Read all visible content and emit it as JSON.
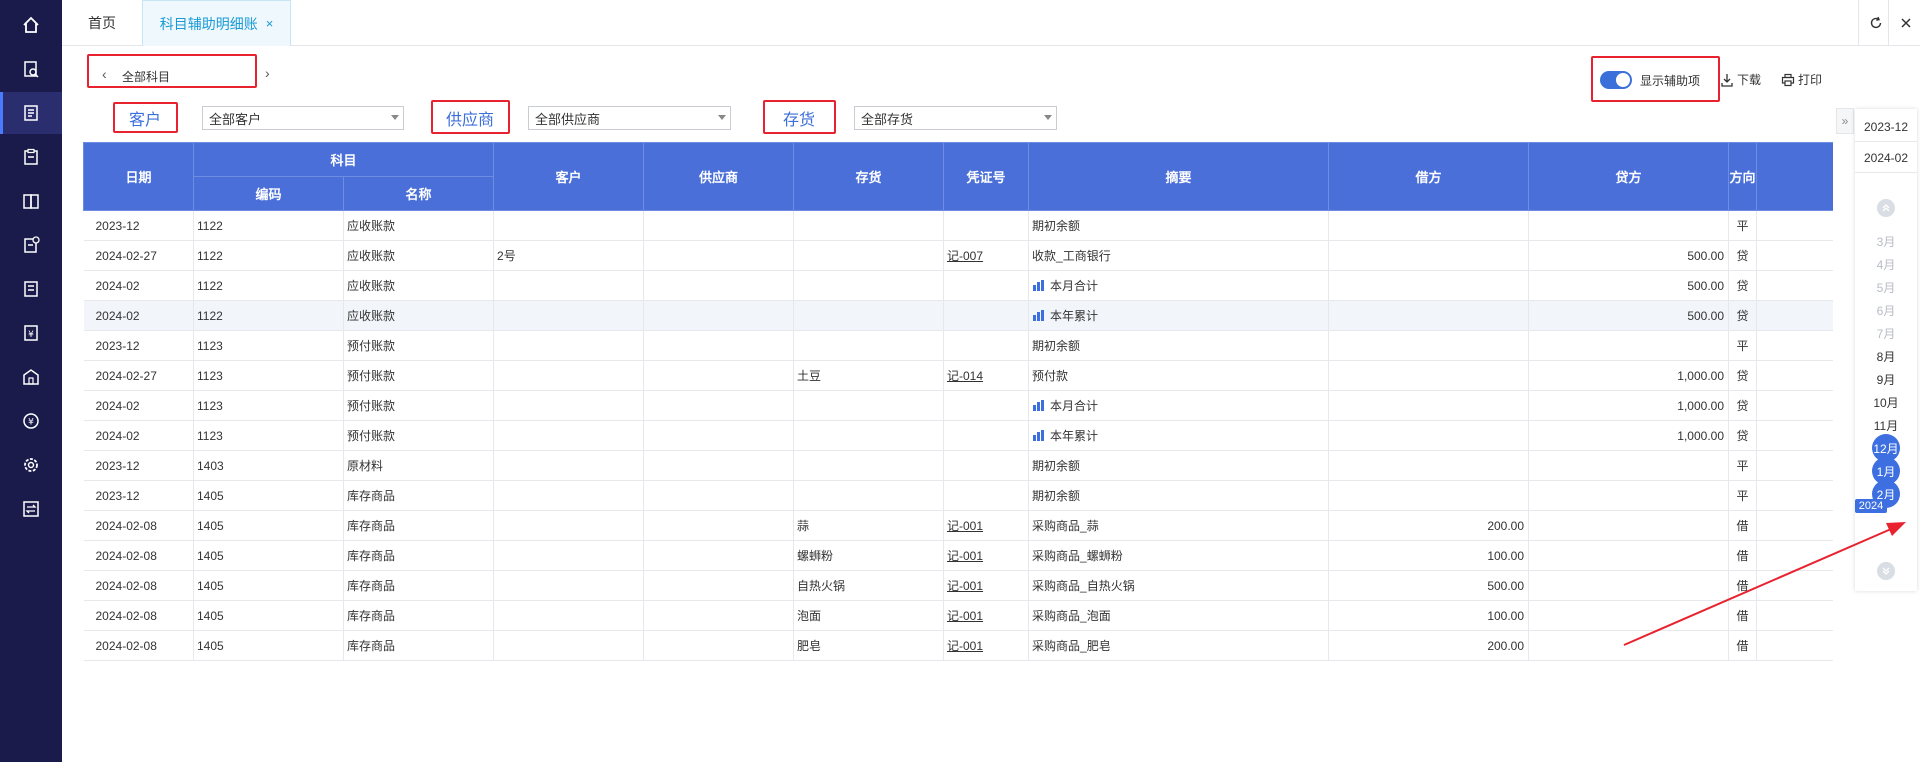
{
  "tabs": {
    "home_label": "首页",
    "active_label": "科目辅助明细账",
    "close_glyph": "×"
  },
  "nav": {
    "subject_label": "全部科目",
    "prev_glyph": "‹",
    "next_glyph": "›"
  },
  "filters": {
    "customer": {
      "label": "客户",
      "value": "全部客户"
    },
    "supplier": {
      "label": "供应商",
      "value": "全部供应商"
    },
    "inventory": {
      "label": "存货",
      "value": "全部存货"
    }
  },
  "toolbar": {
    "toggle_label": "显示辅助项",
    "toggle_on": true,
    "download_label": "下载",
    "print_label": "打印"
  },
  "table": {
    "headers": {
      "date": "日期",
      "subject": "科目",
      "code": "编码",
      "name": "名称",
      "customer": "客户",
      "supplier": "供应商",
      "inventory": "存货",
      "voucher": "凭证号",
      "summary": "摘要",
      "debit": "借方",
      "credit": "贷方",
      "direction": "方向"
    },
    "rows": [
      {
        "date": "2023-12",
        "code": "1122",
        "name": "应收账款",
        "customer": "",
        "supplier": "",
        "inventory": "",
        "voucher": "",
        "summary": "期初余额",
        "summary_icon": false,
        "debit": "",
        "credit": "",
        "direction": "平"
      },
      {
        "date": "2024-02-27",
        "code": "1122",
        "name": "应收账款",
        "customer": "2号",
        "supplier": "",
        "inventory": "",
        "voucher": "记-007",
        "summary": "收款_工商银行",
        "summary_icon": false,
        "debit": "",
        "credit": "500.00",
        "direction": "贷"
      },
      {
        "date": "2024-02",
        "code": "1122",
        "name": "应收账款",
        "customer": "",
        "supplier": "",
        "inventory": "",
        "voucher": "",
        "summary": "本月合计",
        "summary_icon": true,
        "debit": "",
        "credit": "500.00",
        "direction": "贷"
      },
      {
        "date": "2024-02",
        "code": "1122",
        "name": "应收账款",
        "customer": "",
        "supplier": "",
        "inventory": "",
        "voucher": "",
        "summary": "本年累计",
        "summary_icon": true,
        "debit": "",
        "credit": "500.00",
        "direction": "贷"
      },
      {
        "date": "2023-12",
        "code": "1123",
        "name": "预付账款",
        "customer": "",
        "supplier": "",
        "inventory": "",
        "voucher": "",
        "summary": "期初余额",
        "summary_icon": false,
        "debit": "",
        "credit": "",
        "direction": "平"
      },
      {
        "date": "2024-02-27",
        "code": "1123",
        "name": "预付账款",
        "customer": "",
        "supplier": "",
        "inventory": "土豆",
        "voucher": "记-014",
        "summary": "预付款",
        "summary_icon": false,
        "debit": "",
        "credit": "1,000.00",
        "direction": "贷"
      },
      {
        "date": "2024-02",
        "code": "1123",
        "name": "预付账款",
        "customer": "",
        "supplier": "",
        "inventory": "",
        "voucher": "",
        "summary": "本月合计",
        "summary_icon": true,
        "debit": "",
        "credit": "1,000.00",
        "direction": "贷"
      },
      {
        "date": "2024-02",
        "code": "1123",
        "name": "预付账款",
        "customer": "",
        "supplier": "",
        "inventory": "",
        "voucher": "",
        "summary": "本年累计",
        "summary_icon": true,
        "debit": "",
        "credit": "1,000.00",
        "direction": "贷"
      },
      {
        "date": "2023-12",
        "code": "1403",
        "name": "原材料",
        "customer": "",
        "supplier": "",
        "inventory": "",
        "voucher": "",
        "summary": "期初余额",
        "summary_icon": false,
        "debit": "",
        "credit": "",
        "direction": "平"
      },
      {
        "date": "2023-12",
        "code": "1405",
        "name": "库存商品",
        "customer": "",
        "supplier": "",
        "inventory": "",
        "voucher": "",
        "summary": "期初余额",
        "summary_icon": false,
        "debit": "",
        "credit": "",
        "direction": "平"
      },
      {
        "date": "2024-02-08",
        "code": "1405",
        "name": "库存商品",
        "customer": "",
        "supplier": "",
        "inventory": "蒜",
        "voucher": "记-001",
        "summary": "采购商品_蒜",
        "summary_icon": false,
        "debit": "200.00",
        "credit": "",
        "direction": "借"
      },
      {
        "date": "2024-02-08",
        "code": "1405",
        "name": "库存商品",
        "customer": "",
        "supplier": "",
        "inventory": "螺蛳粉",
        "voucher": "记-001",
        "summary": "采购商品_螺蛳粉",
        "summary_icon": false,
        "debit": "100.00",
        "credit": "",
        "direction": "借"
      },
      {
        "date": "2024-02-08",
        "code": "1405",
        "name": "库存商品",
        "customer": "",
        "supplier": "",
        "inventory": "自热火锅",
        "voucher": "记-001",
        "summary": "采购商品_自热火锅",
        "summary_icon": false,
        "debit": "500.00",
        "credit": "",
        "direction": "借"
      },
      {
        "date": "2024-02-08",
        "code": "1405",
        "name": "库存商品",
        "customer": "",
        "supplier": "",
        "inventory": "泡面",
        "voucher": "记-001",
        "summary": "采购商品_泡面",
        "summary_icon": false,
        "debit": "100.00",
        "credit": "",
        "direction": "借"
      },
      {
        "date": "2024-02-08",
        "code": "1405",
        "name": "库存商品",
        "customer": "",
        "supplier": "",
        "inventory": "肥皂",
        "voucher": "记-001",
        "summary": "采购商品_肥皂",
        "summary_icon": false,
        "debit": "200.00",
        "credit": "",
        "direction": "借"
      }
    ],
    "highlighted_row_index": 3
  },
  "periods": {
    "start": "2023-12",
    "end": "2024-02",
    "collapse_glyph": "»",
    "months_dim": [
      "3月",
      "4月",
      "5月",
      "6月",
      "7月"
    ],
    "months_plain": [
      "8月",
      "9月",
      "10月",
      "11月"
    ],
    "months_selected": [
      "12月",
      "1月",
      "2月"
    ],
    "year_tag": "2024"
  },
  "colors": {
    "sidebar_bg": "#1a1b4b",
    "header_blue": "#4a6fd8",
    "accent_blue": "#3d6fe0",
    "active_tab": "#1b9ad6",
    "annotation_red": "#e8232f"
  },
  "sidebar_icons": [
    "home-icon",
    "search-document-icon",
    "ledger-icon",
    "clipboard-icon",
    "book-icon",
    "settings-document-icon",
    "report-icon",
    "yen-icon",
    "building-icon",
    "currency-circle-icon",
    "gear-icon",
    "transfer-icon"
  ]
}
